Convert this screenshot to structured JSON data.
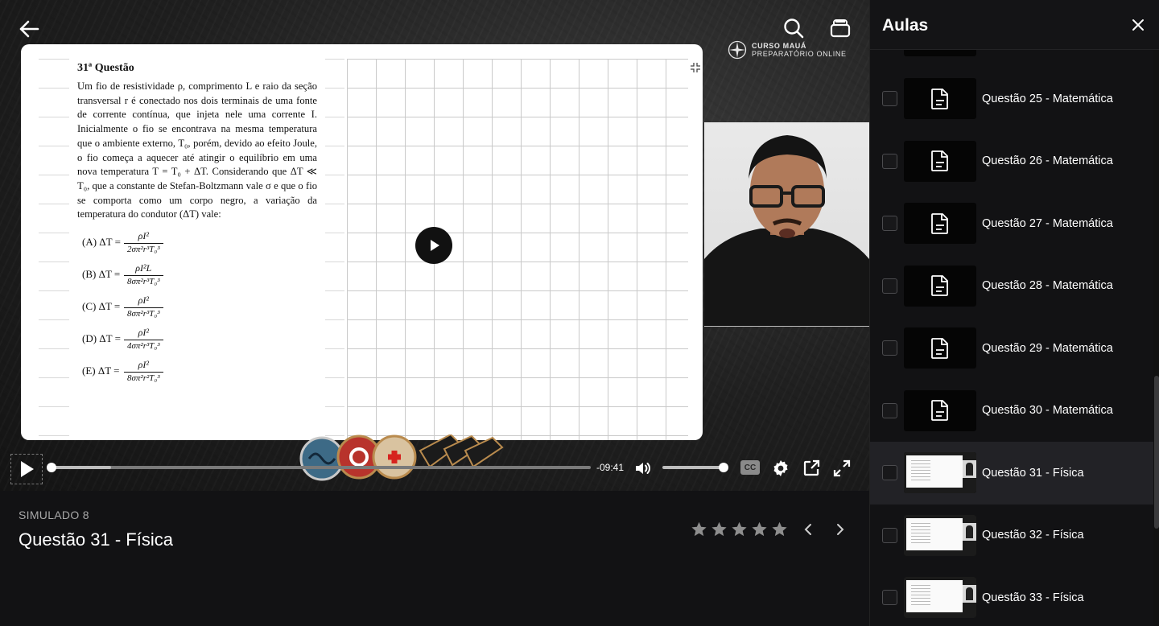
{
  "player": {
    "logo": {
      "line1": "CURSO MAUÁ",
      "line2": "PREPARATÓRIO ONLINE"
    },
    "slide": {
      "question_title": "31ª Questão",
      "question_body": "Um fio de resistividade ρ, comprimento L e raio da seção transversal r é conectado nos dois terminais de uma fonte de corrente contínua, que injeta nele uma corrente I. Inicialmente o fio se encontrava na mesma temperatura que o ambiente externo, T₀, porém, devido ao efeito Joule, o fio começa a aquecer até atingir o equilíbrio em uma nova temperatura T = T₀ + ΔT. Considerando que ΔT ≪ T₀, que a constante de Stefan-Boltzmann vale σ e que o fio se comporta como um corpo negro, a variação da temperatura do condutor (ΔT) vale:",
      "options": [
        {
          "label": "(A)  ΔT =",
          "num": "ρI²",
          "den": "2σπ²r³T₀³"
        },
        {
          "label": "(B)  ΔT =",
          "num": "ρI²L",
          "den": "8σπ²r³T₀³"
        },
        {
          "label": "(C)  ΔT =",
          "num": "ρI²",
          "den": "8σπ²r³T₀³"
        },
        {
          "label": "(D)  ΔT =",
          "num": "ρI²",
          "den": "4σπ²r³T₀³"
        },
        {
          "label": "(E)  ΔT =",
          "num": "ρI²",
          "den": "8σπ²r²T₀³"
        }
      ]
    },
    "controls": {
      "time_remaining": "-09:41",
      "progress_fraction": 0.0,
      "buffered_fraction": 0.11,
      "volume_fraction": 1.0,
      "cc_label": "CC"
    }
  },
  "info": {
    "subtitle": "SIMULADO 8",
    "title": "Questão 31 - Física",
    "rating_max": 5
  },
  "sidebar": {
    "title": "Aulas",
    "items": [
      {
        "label": "Questão 25 - Matemática",
        "type": "document",
        "active": false
      },
      {
        "label": "Questão 26 - Matemática",
        "type": "document",
        "active": false
      },
      {
        "label": "Questão 27 - Matemática",
        "type": "document",
        "active": false
      },
      {
        "label": "Questão 28 - Matemática",
        "type": "document",
        "active": false
      },
      {
        "label": "Questão 29 - Matemática",
        "type": "document",
        "active": false
      },
      {
        "label": "Questão 30 - Matemática",
        "type": "document",
        "active": false
      },
      {
        "label": "Questão 31 - Física",
        "type": "video",
        "active": true
      },
      {
        "label": "Questão 32 - Física",
        "type": "video",
        "active": false
      },
      {
        "label": "Questão 33 - Física",
        "type": "video",
        "active": false
      }
    ]
  },
  "colors": {
    "background": "#121214",
    "active_row": "#222226",
    "accent": "#ffffff"
  }
}
